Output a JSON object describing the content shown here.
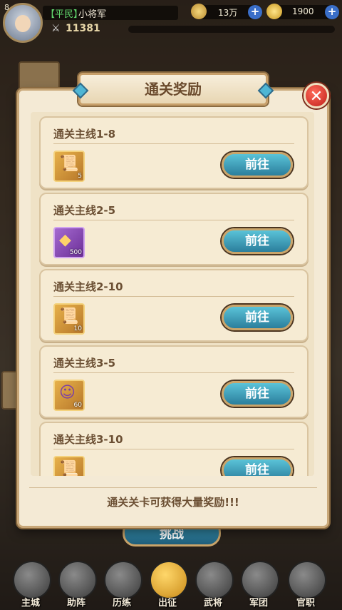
{
  "player": {
    "level": "8",
    "rank": "【平民】",
    "name": "小将军",
    "power": "11381",
    "copper": "13万",
    "gold": "1900"
  },
  "modal": {
    "title": "通关奖励",
    "footer": "通关关卡可获得大量奖励!!!",
    "quests": [
      {
        "title": "通关主线1-8",
        "item_type": "scroll",
        "count": "5",
        "button": "前往"
      },
      {
        "title": "通关主线2-5",
        "item_type": "gold-ingot",
        "count": "500",
        "button": "前往"
      },
      {
        "title": "通关主线2-10",
        "item_type": "scroll",
        "count": "10",
        "button": "前往"
      },
      {
        "title": "通关主线3-5",
        "item_type": "hero-card",
        "count": "60",
        "button": "前往"
      },
      {
        "title": "通关主线3-10",
        "item_type": "scroll",
        "count": "",
        "button": "前往"
      }
    ]
  },
  "challenge_button": "挑战",
  "nav": [
    {
      "label": "主城",
      "icon": "castle-icon",
      "active": false
    },
    {
      "label": "助阵",
      "icon": "shield-icon",
      "active": false
    },
    {
      "label": "历练",
      "icon": "armor-icon",
      "active": false
    },
    {
      "label": "出征",
      "icon": "war-icon",
      "active": true
    },
    {
      "label": "武将",
      "icon": "helmet-icon",
      "active": false
    },
    {
      "label": "军团",
      "icon": "army-icon",
      "active": false
    },
    {
      "label": "官职",
      "icon": "official-icon",
      "active": false
    }
  ]
}
